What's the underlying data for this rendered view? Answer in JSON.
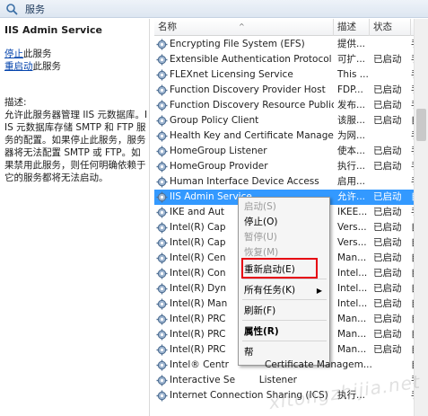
{
  "window": {
    "title": "服务"
  },
  "left_panel": {
    "service_name": "IIS Admin Service",
    "stop_link": "停止",
    "stop_suffix": "此服务",
    "restart_link": "重启动",
    "restart_suffix": "此服务",
    "desc_label": "描述:",
    "description": "允许此服务器管理 IIS 元数据库。IIS 元数据库存储 SMTP 和 FTP 服务的配置。如果停止此服务，服务器将无法配置 SMTP 或 FTP。如果禁用此服务，则任何明确依赖于它的服务都将无法启动。"
  },
  "list": {
    "columns": {
      "name": "名称",
      "desc": "描述",
      "status": "状态",
      "type": "启"
    },
    "rows": [
      {
        "name": "Encrypting File System (EFS)",
        "desc": "提供...",
        "status": "",
        "type": "手"
      },
      {
        "name": "Extensible Authentication Protocol",
        "desc": "可扩...",
        "status": "已启动",
        "type": "手"
      },
      {
        "name": "FLEXnet Licensing Service",
        "desc": "This ...",
        "status": "",
        "type": "手"
      },
      {
        "name": "Function Discovery Provider Host",
        "desc": "FDP...",
        "status": "已启动",
        "type": "手"
      },
      {
        "name": "Function Discovery Resource Publicati...",
        "desc": "发布...",
        "status": "已启动",
        "type": "手"
      },
      {
        "name": "Group Policy Client",
        "desc": "该服...",
        "status": "已启动",
        "type": "自"
      },
      {
        "name": "Health Key and Certificate Managem...",
        "desc": "为网...",
        "status": "",
        "type": "手"
      },
      {
        "name": "HomeGroup Listener",
        "desc": "使本...",
        "status": "已启动",
        "type": "手"
      },
      {
        "name": "HomeGroup Provider",
        "desc": "执行...",
        "status": "已启动",
        "type": "手"
      },
      {
        "name": "Human Interface Device Access",
        "desc": "启用...",
        "status": "",
        "type": "手"
      },
      {
        "name": "IIS Admin Service",
        "desc": "允许...",
        "status": "已启动",
        "type": "自"
      },
      {
        "name": "IKE and Aut",
        "desc": "IKEE...",
        "status": "已启动",
        "type": "手"
      },
      {
        "name": "Intel(R) Cap",
        "desc": "Vers...",
        "status": "已启动",
        "type": "自"
      },
      {
        "name": "Intel(R) Cap",
        "desc": "Vers...",
        "status": "已启动",
        "type": "自"
      },
      {
        "name": "Intel(R) Cen",
        "desc": "Man...",
        "status": "已启动",
        "type": "自"
      },
      {
        "name": "Intel(R) Con",
        "desc": "Intel...",
        "status": "已启动",
        "type": "自"
      },
      {
        "name": "Intel(R) Dyn",
        "desc": "Intel...",
        "status": "已启动",
        "type": "自"
      },
      {
        "name": "Intel(R) Man",
        "desc": "Intel...",
        "status": "已启动",
        "type": "自"
      },
      {
        "name": "Intel(R) PRC",
        "desc": "Man...",
        "status": "已启动",
        "type": "自"
      },
      {
        "name": "Intel(R) PRC",
        "desc": "Man...",
        "status": "已启动",
        "type": "自"
      },
      {
        "name": "Intel(R) PRC",
        "desc": "Man...",
        "status": "已启动",
        "type": "自"
      },
      {
        "name": "Intel® Centr",
        "desc": "Man...",
        "status": "已启动",
        "type": "自"
      },
      {
        "name": "Interactive Se",
        "desc": "使本...",
        "status": "",
        "type": "手"
      },
      {
        "name": "Internet Connection Sharing (ICS)",
        "desc": "执行...",
        "status": "",
        "type": "手"
      }
    ],
    "tail_fragments": {
      "row21": "Certificate Managem...",
      "row22": "Listener"
    }
  },
  "context_menu": {
    "items": [
      {
        "label": "启动(S)",
        "disabled": true
      },
      {
        "label": "停止(O)",
        "disabled": false
      },
      {
        "label": "暂停(U)",
        "disabled": true
      },
      {
        "label": "恢复(M)",
        "disabled": true
      },
      {
        "label": "重新启动(E)",
        "disabled": false
      },
      {
        "label": "所有任务(K)",
        "disabled": false
      },
      {
        "label": "刷新(F)",
        "disabled": false
      },
      {
        "label": "属性(R)",
        "disabled": false
      },
      {
        "label": "帮",
        "disabled": false
      }
    ],
    "submenu_arrow": "▶",
    "highlight_color": "#e60012"
  },
  "colors": {
    "selection": "#3399ff",
    "link": "#0645ad"
  },
  "watermark": "xitongzhijia.net"
}
